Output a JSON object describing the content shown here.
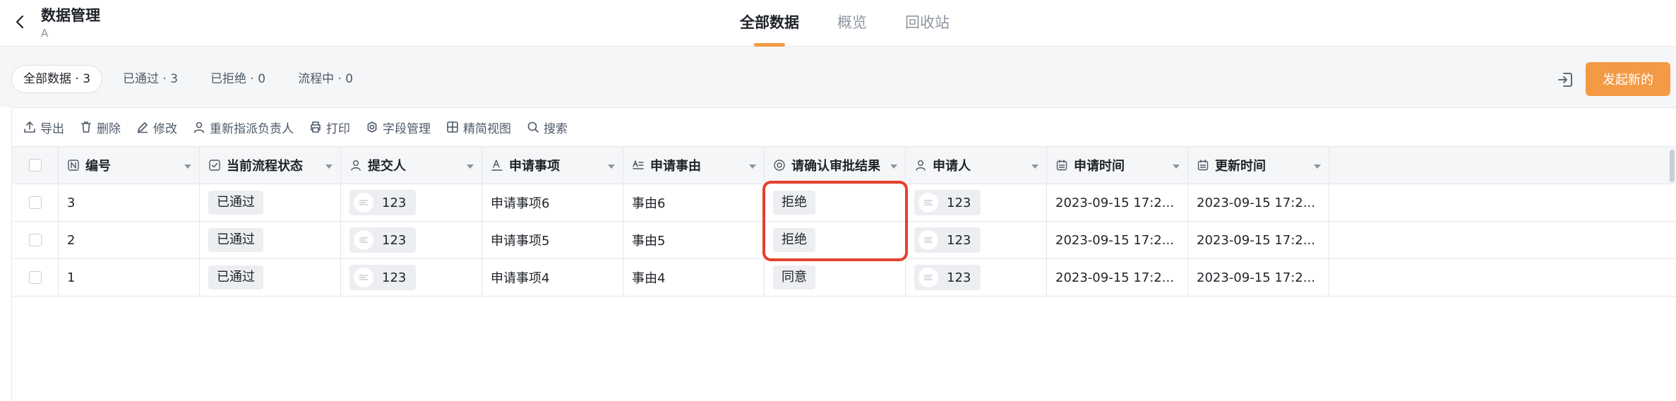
{
  "header": {
    "title": "数据管理",
    "subtitle": "A",
    "back_icon": "chevron-left-icon",
    "tabs": [
      {
        "label": "全部数据",
        "active": true
      },
      {
        "label": "概览",
        "active": false
      },
      {
        "label": "回收站",
        "active": false
      }
    ]
  },
  "filters": {
    "chips": [
      {
        "label": "全部数据 · 3",
        "active": true
      },
      {
        "label": "已通过 · 3",
        "active": false
      },
      {
        "label": "已拒绝 · 0",
        "active": false
      },
      {
        "label": "流程中 · 0",
        "active": false
      }
    ],
    "export_icon": "sign-in-icon",
    "new_button": "发起新的"
  },
  "toolbar": {
    "export": "导出",
    "delete": "删除",
    "edit": "修改",
    "reassign": "重新指派负责人",
    "print": "打印",
    "fields": "字段管理",
    "view": "精简视图",
    "search": "搜索"
  },
  "table": {
    "columns": {
      "number": "编号",
      "status": "当前流程状态",
      "submitter": "提交人",
      "item": "申请事项",
      "reason": "申请事由",
      "approval": "请确认审批结果",
      "applicant": "申请人",
      "apply_time": "申请时间",
      "update_time": "更新时间"
    },
    "rows": [
      {
        "number": "3",
        "status": "已通过",
        "submitter": "123",
        "item": "申请事项6",
        "reason": "事由6",
        "approval": "拒绝",
        "applicant": "123",
        "apply_time": "2023-09-15 17:2...",
        "update_time": "2023-09-15 17:2..."
      },
      {
        "number": "2",
        "status": "已通过",
        "submitter": "123",
        "item": "申请事项5",
        "reason": "事由5",
        "approval": "拒绝",
        "applicant": "123",
        "apply_time": "2023-09-15 17:2...",
        "update_time": "2023-09-15 17:2..."
      },
      {
        "number": "1",
        "status": "已通过",
        "submitter": "123",
        "item": "申请事项4",
        "reason": "事由4",
        "approval": "同意",
        "applicant": "123",
        "apply_time": "2023-09-15 17:2...",
        "update_time": "2023-09-15 17:2..."
      }
    ]
  },
  "colors": {
    "accent": "#f49a45",
    "highlight": "#e5412d",
    "tag_bg": "#eceef1"
  }
}
